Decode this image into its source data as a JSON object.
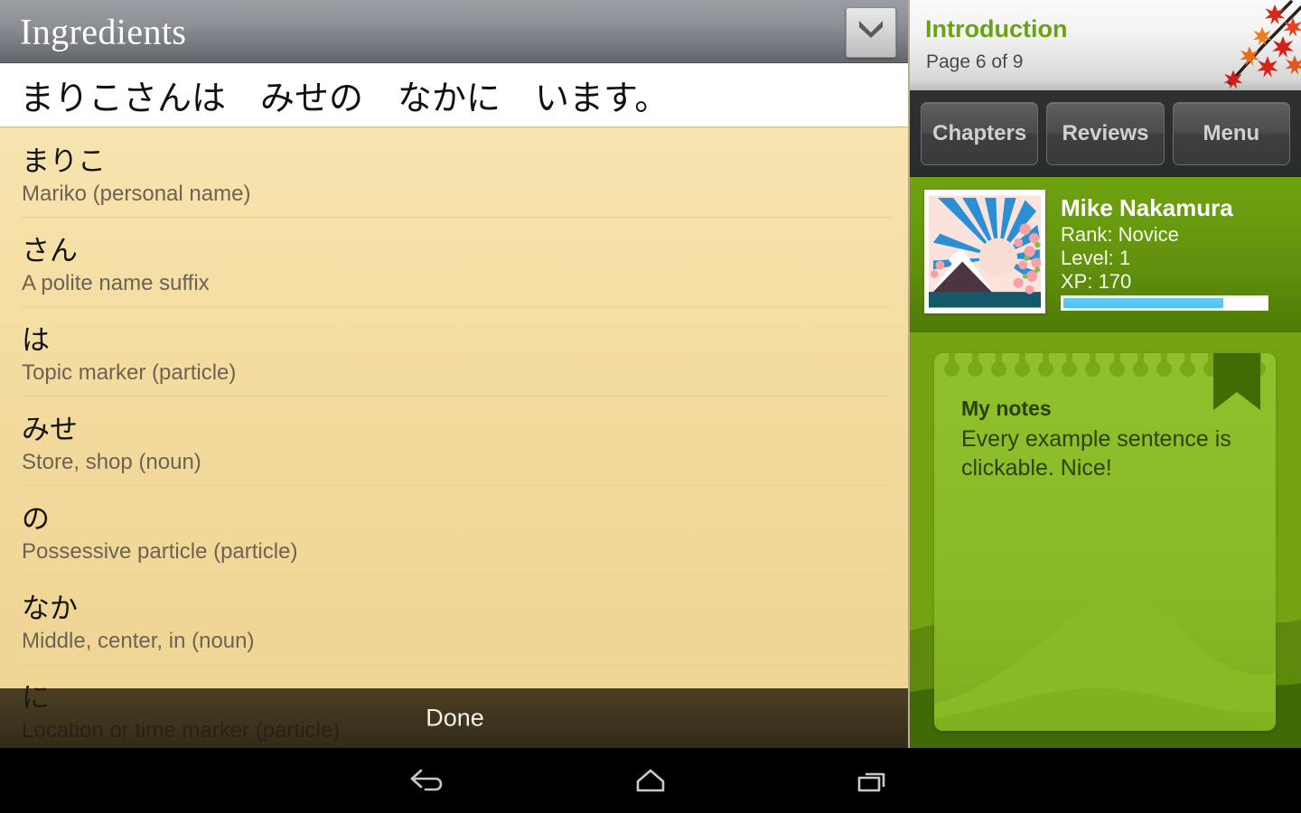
{
  "dialog": {
    "title": "Ingredients",
    "collapse_icon": "chevron-down-icon",
    "sentence": "まりこさんは　みせの　なかに　います。",
    "done_label": "Done",
    "words": [
      {
        "jp": "まりこ",
        "en": "Mariko (personal name)"
      },
      {
        "jp": "さん",
        "en": "A polite name suffix"
      },
      {
        "jp": "は",
        "en": "Topic marker (particle)"
      },
      {
        "jp": "みせ",
        "en": "Store, shop (noun)"
      },
      {
        "jp": "の",
        "en": "Possessive particle (particle)"
      },
      {
        "jp": "なか",
        "en": "Middle, center, in (noun)"
      },
      {
        "jp": "に",
        "en": "Location or time marker (particle)"
      }
    ]
  },
  "book": {
    "chapter_title": "Introduction",
    "page_label": "Page 6 of 9",
    "decoration_icon": "maple-branch-icon",
    "tabs": [
      {
        "label": "Chapters"
      },
      {
        "label": "Reviews"
      },
      {
        "label": "Menu"
      }
    ]
  },
  "profile": {
    "avatar_icon": "mount-fuji-sunrise-avatar",
    "name": "Mike Nakamura",
    "rank": "Rank: Novice",
    "level": "Level: 1",
    "xp": "XP: 170",
    "xp_percent": 79
  },
  "notes": {
    "title": "My notes",
    "body": "Every example sentence is clickable. Nice!",
    "bookmark_icon": "bookmark-ribbon-icon"
  },
  "navbar": {
    "back": "back-icon",
    "home": "home-icon",
    "recents": "recents-icon"
  },
  "colors": {
    "accent_green": "#6aa312",
    "list_background": "#f2d99b",
    "xp_fill": "#4bc3f2",
    "header_gray": "#8e9197"
  }
}
